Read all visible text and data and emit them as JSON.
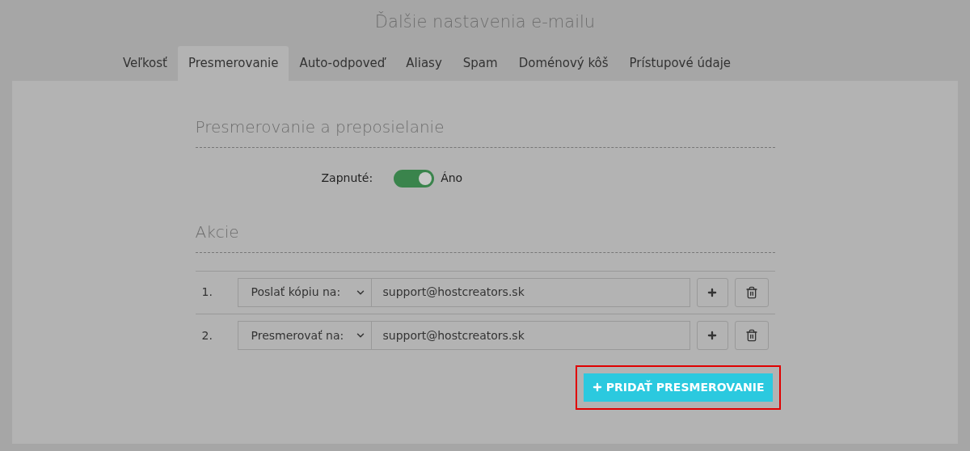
{
  "page_title": "Ďalšie nastavenia e-mailu",
  "tabs": [
    {
      "label": "Veľkosť",
      "selected": false
    },
    {
      "label": "Presmerovanie",
      "selected": true
    },
    {
      "label": "Auto-odpoveď",
      "selected": false
    },
    {
      "label": "Aliasy",
      "selected": false
    },
    {
      "label": "Spam",
      "selected": false
    },
    {
      "label": "Doménový kôš",
      "selected": false
    },
    {
      "label": "Prístupové údaje",
      "selected": false
    }
  ],
  "section_title": "Presmerovanie a preposielanie",
  "enabled": {
    "label": "Zapnuté:",
    "on": true,
    "value_label": "Áno"
  },
  "actions_title": "Akcie",
  "actions": [
    {
      "number": "1.",
      "action": "Poslať kópiu na:",
      "address": "support@hostcreators.sk"
    },
    {
      "number": "2.",
      "action": "Presmerovať na:",
      "address": "support@hostcreators.sk"
    }
  ],
  "add_button": {
    "label": "PRIDAŤ PRESMEROVANIE",
    "highlighted": true
  }
}
